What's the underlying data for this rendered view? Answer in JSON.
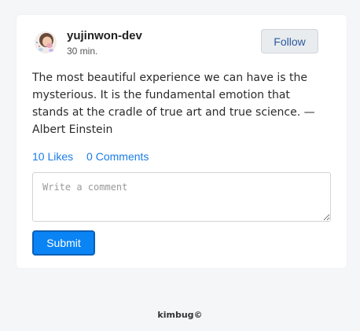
{
  "post": {
    "author": {
      "username": "yujinwon-dev",
      "avatar_icon": "avatar-icon"
    },
    "timestamp": "30 min.",
    "follow_label": "Follow",
    "content": "The most beautiful experience we can have is the mysterious. It is the fundamental emotion that stands at the cradle of true art and true science. — Albert Einstein",
    "likes_label": "10 Likes",
    "comments_label": "0 Comments"
  },
  "comment_form": {
    "placeholder": "Write a comment",
    "value": "",
    "submit_label": "Submit"
  },
  "footer": {
    "text": "kimbug©"
  },
  "colors": {
    "accent": "#0a84f5",
    "link": "#1a7ce8",
    "background": "#f5f6f8"
  }
}
